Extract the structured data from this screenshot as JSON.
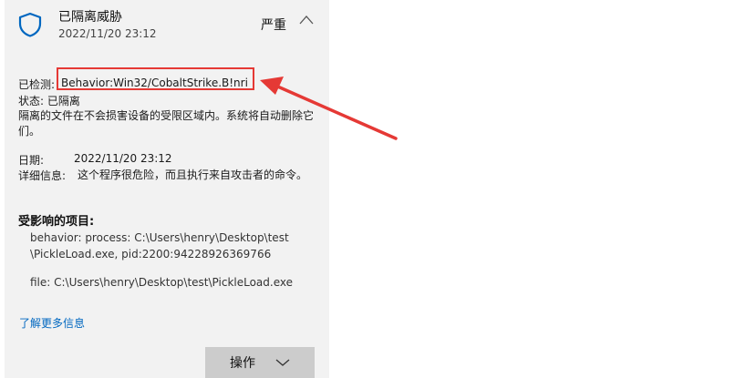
{
  "header": {
    "title": "已隔离威胁",
    "date": "2022/11/20 23:12",
    "severity": "严重"
  },
  "details": {
    "detected_label": "已检测:",
    "detected_value": "Behavior:Win32/CobaltStrike.B!nri",
    "status": "状态: 已隔离",
    "description": "隔离的文件在不会损害设备的受限区域内。系统将自动删除它们。",
    "date_label": "日期:",
    "date_value": "2022/11/20 23:12",
    "details_label": "详细信息:",
    "details_value": "这个程序很危险，而且执行来自攻击者的命令。"
  },
  "affected": {
    "title": "受影响的项目:",
    "items": [
      "behavior: process: C:\\Users\\henry\\Desktop\\test",
      "\\PickleLoad.exe, pid:2200:94228926369766",
      "file: C:\\Users\\henry\\Desktop\\test\\PickleLoad.exe"
    ]
  },
  "links": {
    "more_info": "了解更多信息"
  },
  "actions": {
    "button_label": "操作"
  },
  "colors": {
    "accent": "#0067c0",
    "annotation": "#e53935",
    "panel": "#f2f2f2"
  }
}
